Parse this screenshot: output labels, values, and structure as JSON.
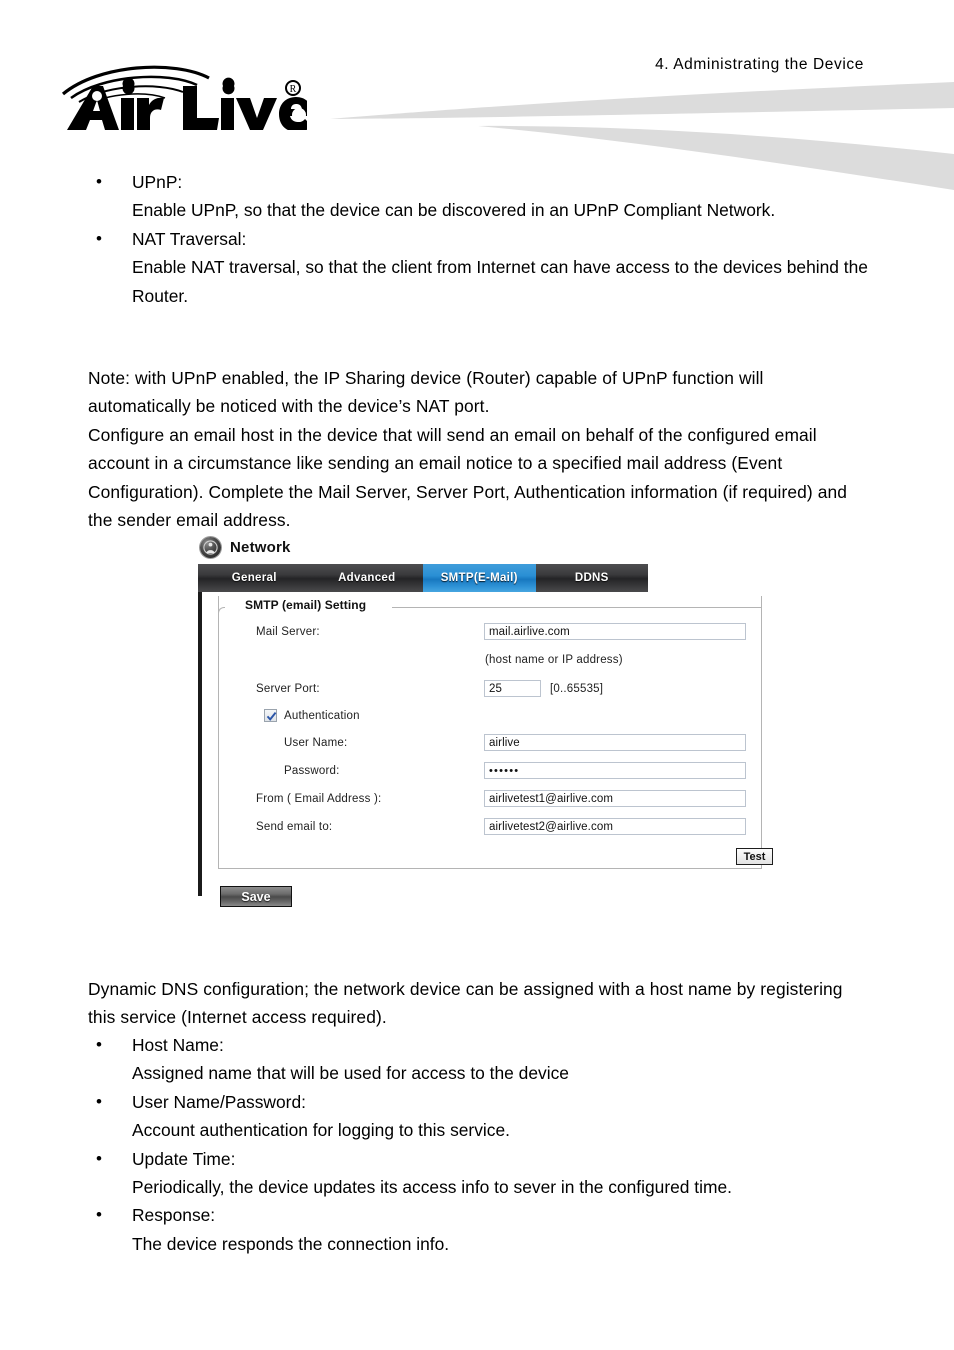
{
  "header": {
    "chapter": "4.  Administrating  the  Device",
    "logo_text": "Air Live",
    "logo_registered": "®"
  },
  "top_bullets": [
    {
      "term": "UPnP:",
      "desc": "Enable UPnP, so that the device can be discovered in an UPnP Compliant Network."
    },
    {
      "term": "NAT Traversal:",
      "desc": "Enable NAT traversal, so that the client from Internet can have access to the devices behind the Router."
    }
  ],
  "note_paragraph": "Note: with UPnP enabled, the IP Sharing device (Router) capable of UPnP function will automatically be noticed with the device’s NAT port.",
  "configure_paragraph": "Configure an email host in the device that will send an email on behalf of the configured email account in a circumstance like sending an email notice to a specified mail address (Event Configuration).    Complete the Mail Server, Server Port, Authentication information (if required) and the sender email address.",
  "ui": {
    "title": "Network",
    "title_icon": "globe-person-icon",
    "tabs": [
      {
        "label": "General",
        "active": false
      },
      {
        "label": "Advanced",
        "active": false
      },
      {
        "label": "SMTP(E-Mail)",
        "active": true
      },
      {
        "label": "DDNS",
        "active": false
      }
    ],
    "fieldset_legend": "SMTP (email) Setting",
    "fields": {
      "mail_server_label": "Mail Server:",
      "mail_server_value": "mail.airlive.com",
      "mail_server_hint": "(host name or IP address)",
      "server_port_label": "Server Port:",
      "server_port_value": "25",
      "server_port_hint": "[0..65535]",
      "authentication_label": "Authentication",
      "authentication_checked": true,
      "user_name_label": "User Name:",
      "user_name_value": "airlive",
      "password_label": "Password:",
      "password_value": "••••••",
      "from_label": "From ( Email Address ):",
      "from_value": "airlivetest1@airlive.com",
      "send_to_label": "Send email to:",
      "send_to_value": "airlivetest2@airlive.com"
    },
    "test_button": "Test",
    "save_button": "Save",
    "accent_color": "#1878c0"
  },
  "ddns_intro": "Dynamic DNS configuration; the network device can be assigned with a host name by registering this service (Internet access required).",
  "bottom_bullets": [
    {
      "term": "Host Name:",
      "desc": "Assigned name that will be used for access to the device"
    },
    {
      "term": "User Name/Password:",
      "desc": "Account authentication for logging to this service."
    },
    {
      "term": "Update Time:",
      "desc": "Periodically, the device updates its access info to sever in the configured time."
    },
    {
      "term": "Response:",
      "desc": "The device responds the connection info."
    }
  ],
  "bullet_glyph": "•"
}
